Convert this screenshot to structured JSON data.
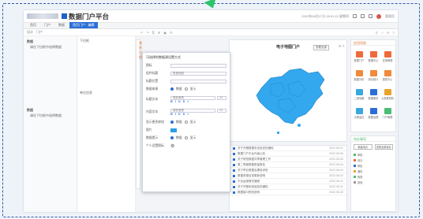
{
  "app": {
    "title": "数据门户平台",
    "datetime": "2022年06月07日 09:51:22 星期四",
    "user": "管理员"
  },
  "tabs": [
    {
      "label": "首页"
    },
    {
      "label": "门户"
    },
    {
      "label": "数据"
    },
    {
      "label": "首页门户 · 编辑",
      "active": true
    }
  ],
  "toolbar": {
    "left": [
      "设计",
      "门户"
    ],
    "mid": [
      "↶",
      "↷",
      "⎘",
      "⊞",
      "▣",
      "⊟"
    ],
    "right": [
      "⚲",
      "☆",
      "⟳",
      "≡"
    ]
  },
  "left_panel": {
    "top_label": "数据",
    "top_hint": "请在下拉框中选择数据",
    "bottom_label": "数据",
    "bottom_hint": "请在下拉框中选择数据"
  },
  "mid_panel": {
    "label1": "下拉框",
    "label2": "单位信息"
  },
  "left_widget": {
    "title": "我的日程"
  },
  "settings_panel": {
    "header": "可选择的数据源设置方式",
    "rows": [
      {
        "label": "图标",
        "value": ""
      },
      {
        "label": "组件标题",
        "value": "数据地图"
      },
      {
        "label": "标题位置",
        "value": ""
      },
      {
        "label": "数据来源",
        "value": "",
        "opt1": "数据",
        "opt2": "显示"
      },
      {
        "label": "标题文本",
        "value": "微软雅黑",
        "size": "14"
      },
      {
        "label": "内容文本",
        "value": "微软雅黑",
        "size": "12"
      },
      {
        "label": "显示更多按钮",
        "value": "",
        "opt1": "数据",
        "opt2": "显示"
      },
      {
        "label": "图片",
        "value": ""
      },
      {
        "label": "数据提示",
        "value": "",
        "opt1": "数据",
        "opt2": "显示"
      },
      {
        "label": "个人设置图标",
        "value": ""
      }
    ],
    "fmt": [
      "B",
      "I",
      "U",
      "S",
      "≡"
    ]
  },
  "map_widget": {
    "title": "电子地图门户",
    "button": "查看全部"
  },
  "app_widget": {
    "title": "应用导航",
    "apps": [
      {
        "label": "数据门户",
        "color": "#ef6a3a"
      },
      {
        "label": "数据中心",
        "color": "#ef6a3a"
      },
      {
        "label": "应用管理",
        "color": "#ef6a3a"
      },
      {
        "label": "数据分析",
        "color": "#f08a3c"
      },
      {
        "label": "综合统计",
        "color": "#f08a3c"
      },
      {
        "label": "报表中心",
        "color": "#f08a3c"
      },
      {
        "label": "二维地图",
        "color": "#39a7e0"
      },
      {
        "label": "数据服务",
        "color": "#2b6fd6"
      },
      {
        "label": "九宫格导航",
        "color": "#e8a32b"
      },
      {
        "label": "大屏监控",
        "color": "#39a7e0"
      },
      {
        "label": "数据治理",
        "color": "#2b6fd6"
      },
      {
        "label": "门户管理",
        "color": "#4bbd74"
      }
    ]
  },
  "list_widget": {
    "rows": [
      {
        "text": "关于开展数据安全检查的通知",
        "date": "2022-06-07"
      },
      {
        "text": "数据门户平台升级公告",
        "date": "2022-06-06"
      },
      {
        "text": "关于规范数据共享管理工作",
        "date": "2022-06-05"
      },
      {
        "text": "第二季度数据质量报告",
        "date": "2022-06-04"
      },
      {
        "text": "关于举办数据治理培训班",
        "date": "2022-06-03"
      },
      {
        "text": "数据资源目录更新说明",
        "date": "2022-06-02"
      },
      {
        "text": "平台运维情况通报",
        "date": "2022-06-01"
      },
      {
        "text": "关于开展系统巡检的通知",
        "date": "2022-05-31"
      },
      {
        "text": "数据接口规范说明",
        "date": "2022-05-30"
      }
    ]
  },
  "side2_widget": {
    "title": "待办事项",
    "buttons": [
      "新建待办",
      "查看全部待办"
    ],
    "items": [
      {
        "label": "审核",
        "color": "#4bbd74"
      },
      {
        "label": "待办",
        "color": "#ef6a3a"
      },
      {
        "label": "审批",
        "color": "#2b6fd6"
      },
      {
        "label": "通知",
        "color": "#e8a32b"
      },
      {
        "label": "报表",
        "color": "#4bbd74"
      },
      {
        "label": "其他",
        "color": "#999999"
      }
    ]
  }
}
